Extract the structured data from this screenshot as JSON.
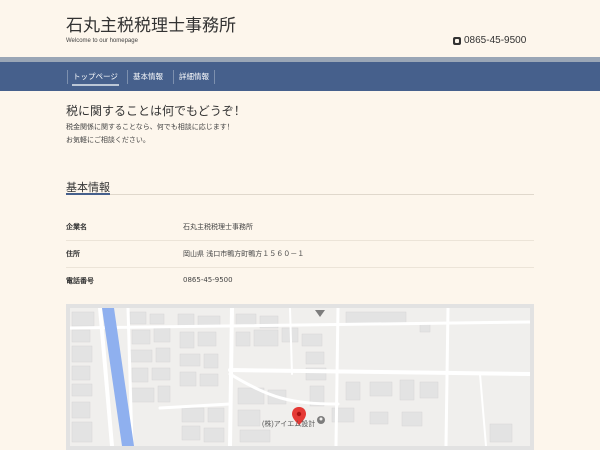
{
  "header": {
    "site_title": "石丸主税税理士事務所",
    "tagline": "Welcome to our homepage",
    "phone": "0865-45-9500"
  },
  "nav": {
    "items": [
      {
        "label": "トップページ",
        "active": true
      },
      {
        "label": "基本情報",
        "active": false
      },
      {
        "label": "詳細情報",
        "active": false
      }
    ]
  },
  "intro": {
    "heading": "税に関することは何でもどうぞ！",
    "lines": [
      "税金関係に関することなら、何でも相談に応じます！",
      "お気軽にご相談ください。"
    ]
  },
  "section": {
    "title": "基本情報"
  },
  "info": [
    {
      "label": "企業名",
      "value": "石丸主税税理士事務所"
    },
    {
      "label": "住所",
      "value": "岡山県 浅口市鴨方町鴨方１５６０－１"
    },
    {
      "label": "電話番号",
      "value": "0865-45-9500"
    }
  ],
  "map": {
    "place_label": "(株)アイエム設計"
  },
  "colors": {
    "nav_bg": "#46608c",
    "page_bg": "#fdf6ec",
    "map_pin": "#e53935",
    "river": "#8fb0ef"
  }
}
